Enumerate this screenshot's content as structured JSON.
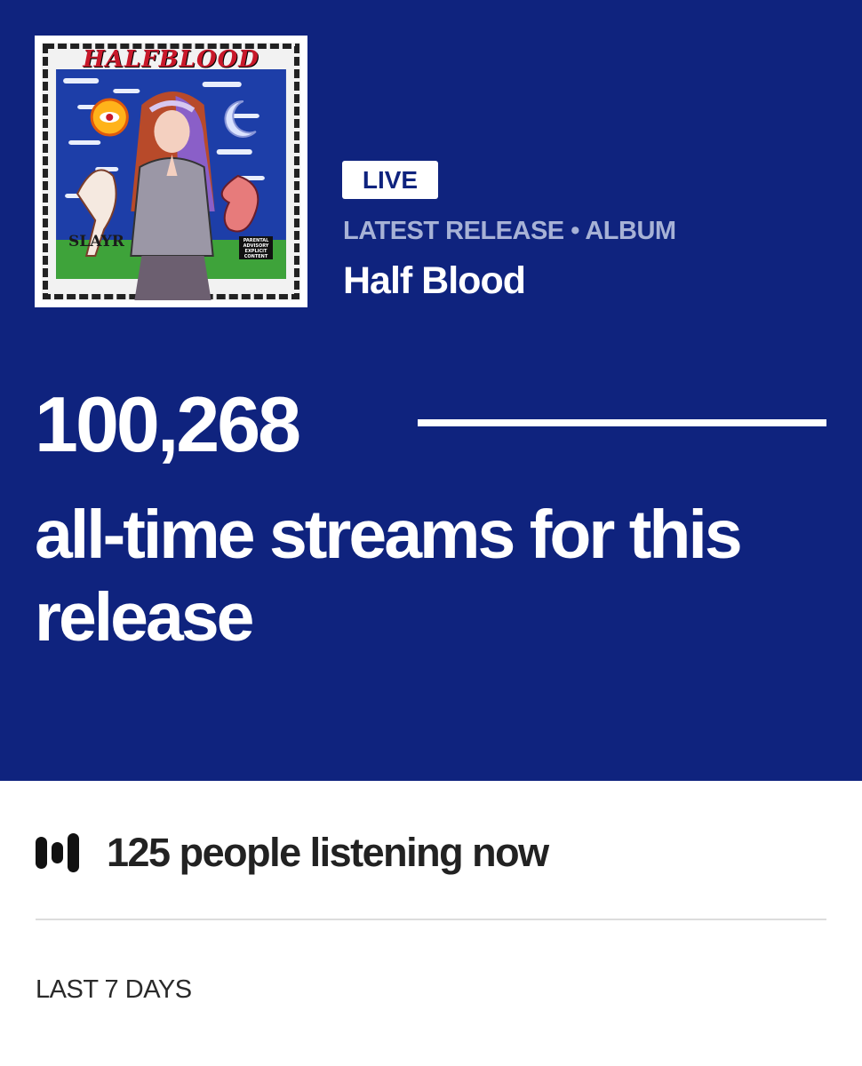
{
  "release": {
    "cover_title": "HALFBLOOD",
    "cover_artist": "SLAYR",
    "cover_advisory": "PARENTAL ADVISORY EXPLICIT CONTENT",
    "status_badge": "LIVE",
    "meta": "LATEST RELEASE • ALBUM",
    "title": "Half Blood"
  },
  "stats": {
    "all_time_streams": "100,268",
    "caption": "all-time streams for this release"
  },
  "listening": {
    "icon": "audio-bars-icon",
    "text": "125 people listening now"
  },
  "period": {
    "label": "LAST 7 DAYS"
  },
  "colors": {
    "hero_bg": "#0f237e",
    "meta_text": "#a7b2d6",
    "badge_bg": "#ffffff"
  }
}
